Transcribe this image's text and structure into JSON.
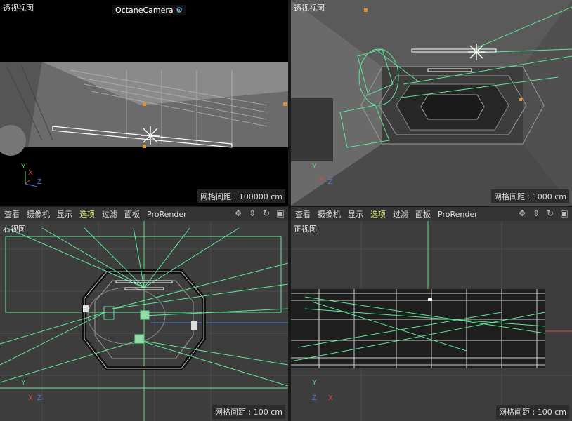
{
  "viewports": {
    "top_left": {
      "title": "透视视图",
      "camera": "OctaneCamera",
      "grid": "网格间距 : 100000 cm"
    },
    "top_right": {
      "title": "透视视图",
      "grid": "网格间距 : 1000 cm"
    },
    "bottom_left": {
      "title": "右视图",
      "grid": "网格间距 : 100 cm"
    },
    "bottom_right": {
      "title": "正视图",
      "grid": "网格间距 : 100 cm"
    }
  },
  "menus": {
    "left": [
      "查看",
      "摄像机",
      "显示",
      "选项",
      "过滤",
      "面板",
      "ProRender"
    ],
    "right": [
      "查看",
      "摄像机",
      "显示",
      "选项",
      "过滤",
      "面板",
      "ProRender"
    ],
    "active_index": 3
  },
  "axes": {
    "y": "Y",
    "x": "X",
    "z": "Z"
  },
  "colors": {
    "accent": "#c9e26a",
    "wire_green": "#5fe39a",
    "axis_y": "#5fdc7a",
    "axis_x": "#e04a4a",
    "axis_z": "#4a7de0"
  }
}
